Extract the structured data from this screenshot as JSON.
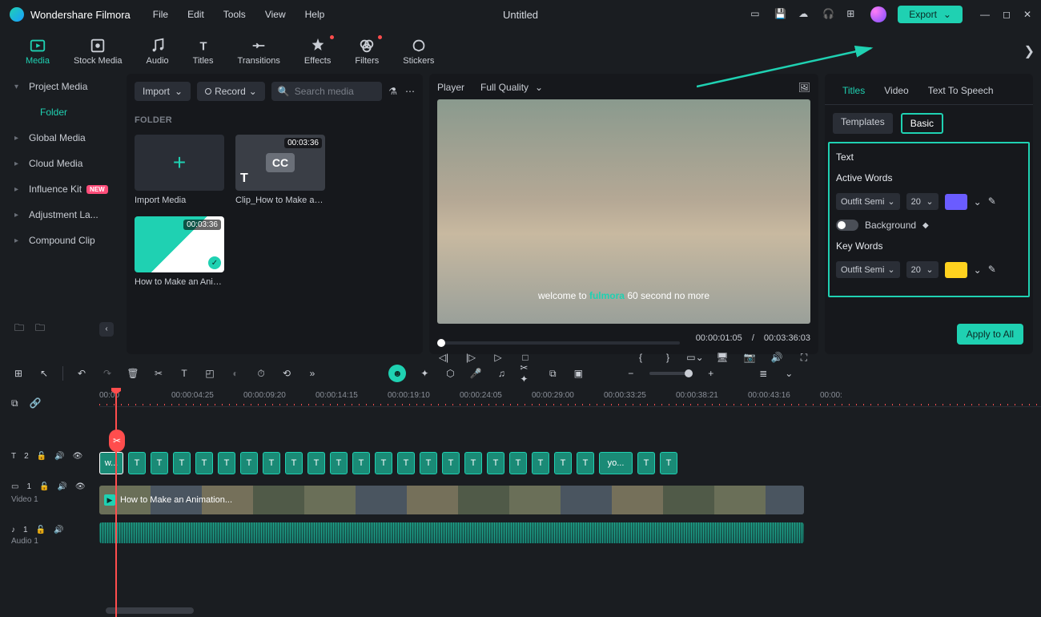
{
  "app_name": "Wondershare Filmora",
  "doc_title": "Untitled",
  "menu": [
    "File",
    "Edit",
    "Tools",
    "View",
    "Help"
  ],
  "export_label": "Export",
  "main_tools": [
    {
      "id": "media",
      "label": "Media"
    },
    {
      "id": "stock",
      "label": "Stock Media"
    },
    {
      "id": "audio",
      "label": "Audio"
    },
    {
      "id": "titles",
      "label": "Titles"
    },
    {
      "id": "transitions",
      "label": "Transitions"
    },
    {
      "id": "effects",
      "label": "Effects"
    },
    {
      "id": "filters",
      "label": "Filters"
    },
    {
      "id": "stickers",
      "label": "Stickers"
    }
  ],
  "project_tree": {
    "root": "Project Media",
    "active": "Folder",
    "items": [
      "Global Media",
      "Cloud Media",
      "Influence Kit",
      "Adjustment La...",
      "Compound Clip"
    ],
    "new_badge_index": 2
  },
  "media_browser": {
    "import_label": "Import",
    "record_label": "Record",
    "search_placeholder": "Search media",
    "folder_heading": "FOLDER",
    "tiles": [
      {
        "kind": "import",
        "caption": "Import Media"
      },
      {
        "kind": "cc",
        "caption": "Clip_How to Make an ...",
        "duration": "00:03:36"
      },
      {
        "kind": "video",
        "caption": "How to Make an Anim...",
        "duration": "00:03:36"
      }
    ]
  },
  "player": {
    "label": "Player",
    "quality": "Full Quality",
    "overlay_pre": "welcome to ",
    "overlay_hl": "fulmora",
    "overlay_post": " 60 second no more",
    "current_time": "00:00:01:05",
    "separator": "/",
    "total_time": "00:03:36:03"
  },
  "inspector": {
    "tabs": [
      "Titles",
      "Video",
      "Text To Speech"
    ],
    "active_tab": 0,
    "subtabs": [
      "Templates",
      "Basic"
    ],
    "active_subtab": 1,
    "text_heading": "Text",
    "active_words_heading": "Active Words",
    "keywords_heading": "Key Words",
    "font_name": "Outfit Semi",
    "font_size": "20",
    "bg_label": "Background",
    "colors": {
      "active": "#6a5cff",
      "key": "#ffd21f"
    },
    "apply_all": "Apply to All"
  },
  "timeline": {
    "ruler_ticks": [
      "00:00",
      "00:00:04:25",
      "00:00:09:20",
      "00:00:14:15",
      "00:00:19:10",
      "00:00:24:05",
      "00:00:29:00",
      "00:00:33:25",
      "00:00:38:21",
      "00:00:43:16",
      "00:00:"
    ],
    "tick_positions": [
      0,
      90,
      180,
      270,
      360,
      450,
      540,
      630,
      720,
      810,
      900
    ],
    "text_track_label_a": "2",
    "text_track_head": "T",
    "text_clip_first": "w...",
    "text_clip_last": "yo...",
    "text_clip_widths": [
      30,
      22,
      22,
      22,
      22,
      22,
      22,
      22,
      22,
      22,
      22,
      22,
      22,
      22,
      22,
      22,
      22,
      22,
      22,
      22,
      22,
      22,
      42,
      22,
      22
    ],
    "video_track_count": "1",
    "video_track_name": "Video 1",
    "video_clip_label": "How to Make an Animation...",
    "audio_track_count": "1",
    "audio_track_name": "Audio 1"
  }
}
